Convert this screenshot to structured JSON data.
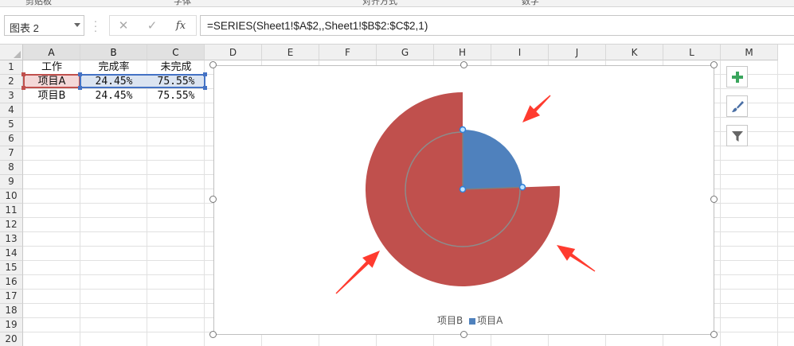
{
  "ribbon": {
    "groups": [
      "剪贴板",
      "字体",
      "对齐方式",
      "数字"
    ]
  },
  "formula_bar": {
    "name_box": "图表 2",
    "cancel_icon": "✕",
    "enter_icon": "✓",
    "fx_label": "fx",
    "formula": "=SERIES(Sheet1!$A$2,,Sheet1!$B$2:$C$2,1)"
  },
  "columns": [
    "A",
    "B",
    "C",
    "D",
    "E",
    "F",
    "G",
    "H",
    "I",
    "J",
    "K",
    "L",
    "M"
  ],
  "rows": [
    "1",
    "2",
    "3",
    "4",
    "5",
    "6",
    "7",
    "8",
    "9",
    "10",
    "11",
    "12",
    "13",
    "14",
    "15",
    "16",
    "17",
    "18",
    "19",
    "20"
  ],
  "cells": {
    "A1": "工作",
    "B1": "完成率",
    "C1": "未完成",
    "A2": "项目A",
    "B2": "24.45%",
    "C2": "75.55%",
    "A3": "项目B",
    "B3": "24.45%",
    "C3": "75.55%"
  },
  "chart": {
    "legend": [
      {
        "label": "项目B",
        "color": "#c0504d"
      },
      {
        "label": "项目A",
        "color": "#4f81bd"
      }
    ],
    "colors": {
      "series_b": "#c0504d",
      "series_a": "#4f81bd",
      "arrow": "#ff3b2f"
    }
  },
  "chart_data": {
    "type": "pie",
    "categories": [
      "完成率",
      "未完成"
    ],
    "series": [
      {
        "name": "项目A",
        "values": [
          24.45,
          75.55
        ],
        "visible": [
          true,
          false
        ]
      },
      {
        "name": "项目B",
        "values": [
          24.45,
          75.55
        ],
        "visible": [
          false,
          true
        ]
      }
    ],
    "legend": "bottom"
  },
  "side_buttons": [
    "plus-icon",
    "brush-icon",
    "filter-icon"
  ]
}
